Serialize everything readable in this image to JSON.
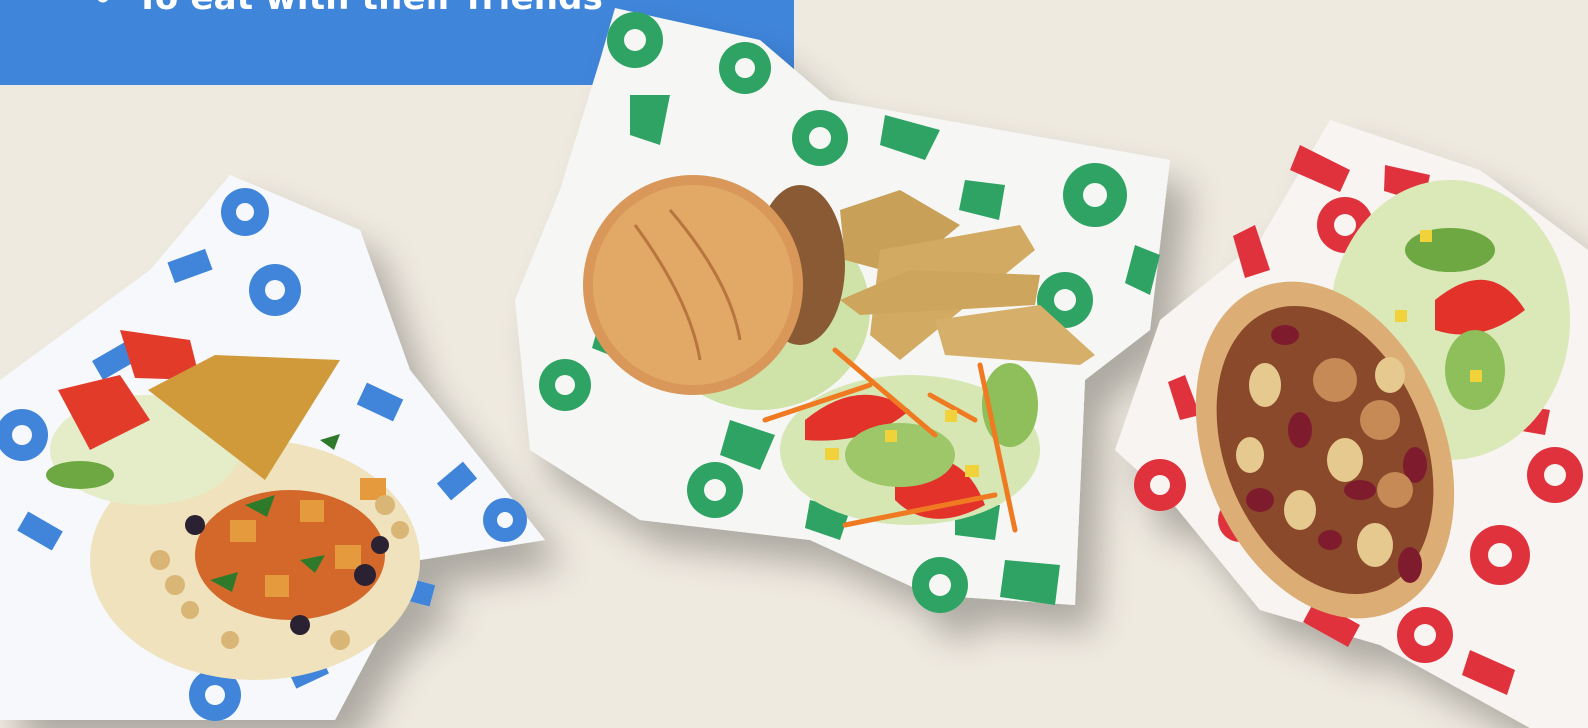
{
  "banner": {
    "bullet": "•",
    "text": "To eat with their friends",
    "color": "#3f85da"
  },
  "background_color": "#efeae0",
  "dishes": [
    {
      "name": "Curry with rice, chickpeas, salad and flatbread",
      "paper_color": "#3f85da"
    },
    {
      "name": "Burger with potato wedges and salad",
      "paper_color": "#2fa363"
    },
    {
      "name": "Bean stew in pitta with salad",
      "paper_color": "#e0323e"
    }
  ]
}
